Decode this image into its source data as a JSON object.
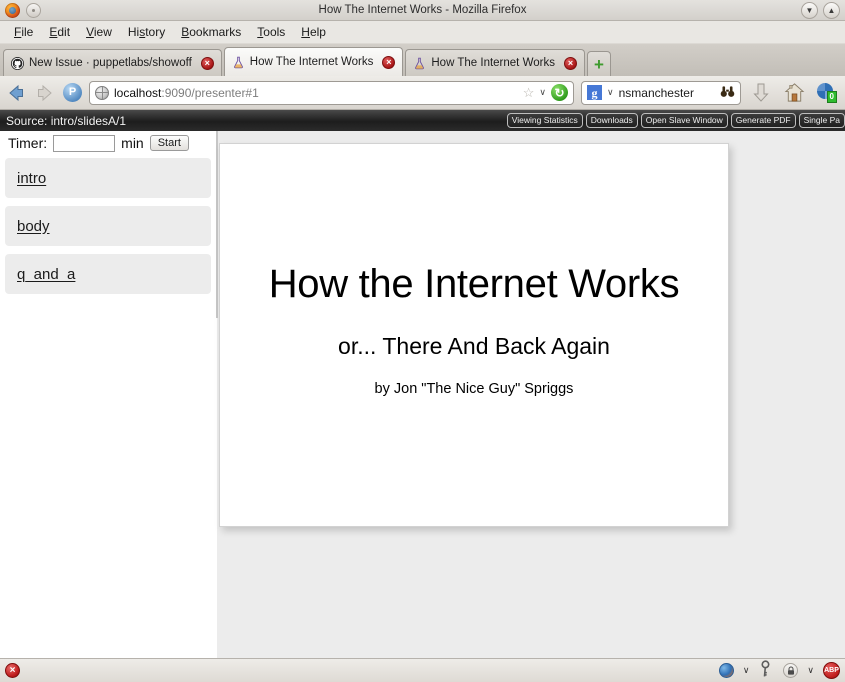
{
  "window": {
    "title": "How The Internet Works - Mozilla Firefox",
    "logo_icon": "firefox-logo",
    "menu_dot_icon": "window-menu-icon",
    "minimize_icon": "chevron-down-icon",
    "maximize_icon": "chevron-up-icon"
  },
  "menubar": {
    "items": [
      {
        "pre": "",
        "key": "F",
        "post": "ile"
      },
      {
        "pre": "",
        "key": "E",
        "post": "dit"
      },
      {
        "pre": "",
        "key": "V",
        "post": "iew"
      },
      {
        "pre": "Hi",
        "key": "s",
        "post": "tory"
      },
      {
        "pre": "",
        "key": "B",
        "post": "ookmarks"
      },
      {
        "pre": "",
        "key": "T",
        "post": "ools"
      },
      {
        "pre": "",
        "key": "H",
        "post": "elp"
      }
    ]
  },
  "tabs": {
    "items": [
      {
        "label": "New Issue · puppetlabs/showoff",
        "favicon": "github-icon",
        "active": false
      },
      {
        "label": "How The Internet Works",
        "favicon": "flask-icon",
        "active": true
      },
      {
        "label": "How The Internet Works",
        "favicon": "flask-icon",
        "active": false
      }
    ],
    "close_glyph": "×",
    "new_tab_label": "+"
  },
  "navbar": {
    "back_icon": "back-arrow-icon",
    "forward_icon": "forward-arrow-icon",
    "pocket_label": "P",
    "site_icon": "globe-icon",
    "url_host": "localhost",
    "url_path": ":9090/presenter#1",
    "bookmark_glyph": "☆",
    "dropdown_glyph": "∨",
    "reload_glyph": "↻",
    "search_engine": "g",
    "search_value": "nsmanchester",
    "binoculars_glyph": "··",
    "download_icon": "download-arrow-icon",
    "home_icon": "home-icon",
    "weather_badge": "0"
  },
  "showoff": {
    "source_label": "Source: intro/slidesA/1",
    "buttons": [
      "Viewing Statistics",
      "Downloads",
      "Open Slave Window",
      "Generate PDF",
      "Single Pa"
    ]
  },
  "presenter": {
    "timer_label": "Timer:",
    "timer_value": "",
    "timer_placeholder": "",
    "timer_unit": "min",
    "timer_start_label": "Start",
    "sections": [
      {
        "label": "intro"
      },
      {
        "label": "body"
      },
      {
        "label": "q_and_a"
      }
    ]
  },
  "slide": {
    "title": "How the Internet Works",
    "subtitle": "or... There And Back Again",
    "author": "by Jon \"The Nice Guy\" Spriggs"
  },
  "statusbar": {
    "error_glyph": "×",
    "globe_icon": "network-globe-icon",
    "globe_chevron": "∨",
    "key_icon": "key-icon",
    "lock_icon": "lock-icon",
    "lock_glyph": "■",
    "lock_chevron": "∨",
    "adblock_label": "ABP"
  },
  "colors": {
    "accent_blue": "#4678d6",
    "slide_bg": "#ffffff",
    "pane_bg": "#ececec",
    "toolbar_dark": "#1d1d1d"
  }
}
